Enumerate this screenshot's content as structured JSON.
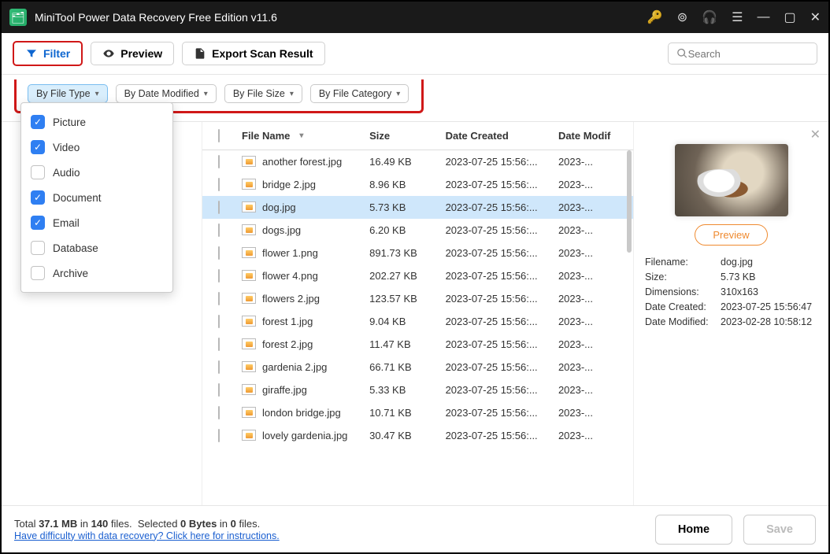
{
  "titlebar": {
    "title": "MiniTool Power Data Recovery Free Edition v11.6"
  },
  "toolbar": {
    "filter": "Filter",
    "preview": "Preview",
    "export": "Export Scan Result",
    "search_placeholder": "Search"
  },
  "chips": {
    "file_type": "By File Type",
    "date_modified": "By Date Modified",
    "file_size": "By File Size",
    "file_category": "By File Category"
  },
  "type_filter": {
    "options": [
      {
        "label": "Picture",
        "checked": true
      },
      {
        "label": "Video",
        "checked": true
      },
      {
        "label": "Audio",
        "checked": false
      },
      {
        "label": "Document",
        "checked": true
      },
      {
        "label": "Email",
        "checked": true
      },
      {
        "label": "Database",
        "checked": false
      },
      {
        "label": "Archive",
        "checked": false
      }
    ]
  },
  "columns": {
    "name": "File Name",
    "size": "Size",
    "date_created": "Date Created",
    "date_modified": "Date Modif"
  },
  "files": [
    {
      "name": "another forest.jpg",
      "size": "16.49 KB",
      "created": "2023-07-25 15:56:...",
      "modified": "2023-..."
    },
    {
      "name": "bridge 2.jpg",
      "size": "8.96 KB",
      "created": "2023-07-25 15:56:...",
      "modified": "2023-..."
    },
    {
      "name": "dog.jpg",
      "size": "5.73 KB",
      "created": "2023-07-25 15:56:...",
      "modified": "2023-...",
      "selected": true
    },
    {
      "name": "dogs.jpg",
      "size": "6.20 KB",
      "created": "2023-07-25 15:56:...",
      "modified": "2023-..."
    },
    {
      "name": "flower 1.png",
      "size": "891.73 KB",
      "created": "2023-07-25 15:56:...",
      "modified": "2023-..."
    },
    {
      "name": "flower 4.png",
      "size": "202.27 KB",
      "created": "2023-07-25 15:56:...",
      "modified": "2023-..."
    },
    {
      "name": "flowers 2.jpg",
      "size": "123.57 KB",
      "created": "2023-07-25 15:56:...",
      "modified": "2023-..."
    },
    {
      "name": "forest 1.jpg",
      "size": "9.04 KB",
      "created": "2023-07-25 15:56:...",
      "modified": "2023-..."
    },
    {
      "name": "forest 2.jpg",
      "size": "11.47 KB",
      "created": "2023-07-25 15:56:...",
      "modified": "2023-..."
    },
    {
      "name": "gardenia 2.jpg",
      "size": "66.71 KB",
      "created": "2023-07-25 15:56:...",
      "modified": "2023-..."
    },
    {
      "name": "giraffe.jpg",
      "size": "5.33 KB",
      "created": "2023-07-25 15:56:...",
      "modified": "2023-..."
    },
    {
      "name": "london bridge.jpg",
      "size": "10.71 KB",
      "created": "2023-07-25 15:56:...",
      "modified": "2023-..."
    },
    {
      "name": "lovely gardenia.jpg",
      "size": "30.47 KB",
      "created": "2023-07-25 15:56:...",
      "modified": "2023-..."
    }
  ],
  "details": {
    "preview": "Preview",
    "rows": [
      {
        "k": "Filename:",
        "v": "dog.jpg"
      },
      {
        "k": "Size:",
        "v": "5.73 KB"
      },
      {
        "k": "Dimensions:",
        "v": "310x163"
      },
      {
        "k": "Date Created:",
        "v": "2023-07-25 15:56:47"
      },
      {
        "k": "Date Modified:",
        "v": "2023-02-28 10:58:12"
      }
    ]
  },
  "status": {
    "line_html": "Total <b>37.1 MB</b> in <b>140</b> files.&nbsp;&nbsp;Selected <b>0 Bytes</b> in <b>0</b> files.",
    "help": "Have difficulty with data recovery? Click here for instructions.",
    "home": "Home",
    "save": "Save"
  }
}
